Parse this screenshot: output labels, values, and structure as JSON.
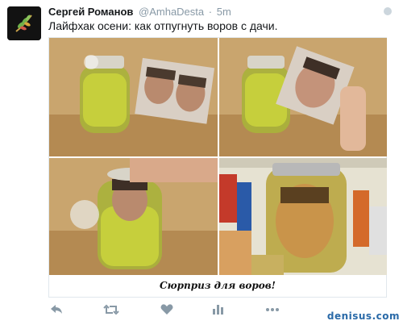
{
  "tweet": {
    "author_name": "Сергей Романов",
    "handle": "@AmhaDesta",
    "separator": "·",
    "time": "5m",
    "text": "Лайфхак осени: как отпугнуть воров с дачи.",
    "avatar_icon": "leaf-sprig-logo-icon",
    "accent_color": "#8899a6"
  },
  "media": {
    "caption": "Сюрприз для воров!",
    "panels": [
      {
        "name": "jar-with-head-photo"
      },
      {
        "name": "placing-photo-in-jar"
      },
      {
        "name": "closing-jar-lid"
      },
      {
        "name": "jar-head-in-fridge"
      }
    ]
  },
  "actions": {
    "items": [
      "reply-icon",
      "retweet-icon",
      "like-icon",
      "analytics-icon",
      "more-icon"
    ]
  },
  "watermark": "denisus.com"
}
